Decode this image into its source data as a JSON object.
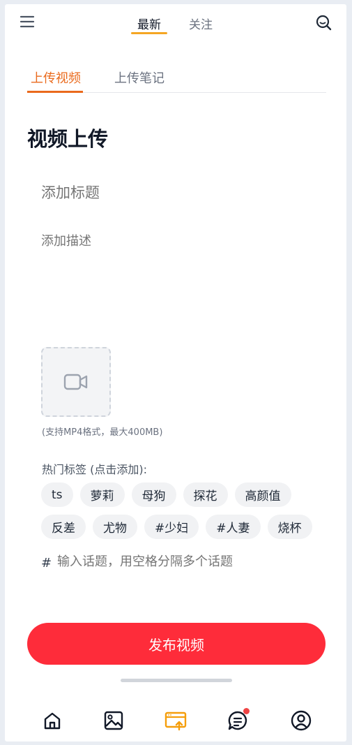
{
  "topnav": {
    "tabs": [
      "最新",
      "关注"
    ],
    "active_tab": "最新",
    "menu_icon": "hamburger-menu-icon",
    "search_icon": "search-icon"
  },
  "subtabs": {
    "items": [
      "上传视频",
      "上传笔记"
    ],
    "active": "上传视频"
  },
  "page": {
    "title": "视频上传"
  },
  "form": {
    "title_placeholder": "添加标题",
    "description_placeholder": "添加描述",
    "upload_icon": "video-camera-icon",
    "upload_hint": "(支持MP4格式，最大400MB)",
    "tags_label": "热门标签 (点击添加):",
    "tags_row1": [
      "ts",
      "萝莉",
      "母狗",
      "探花",
      "高颜值"
    ],
    "tags_row2": [
      "反差",
      "尤物",
      "#少妇",
      "#人妻",
      "烧杯"
    ],
    "topic_hash": "#",
    "topic_placeholder": "输入话题，用空格分隔多个话题",
    "publish_label": "发布视频"
  },
  "bottomnav": {
    "items": [
      "home-icon",
      "image-gallery-icon",
      "upload-icon",
      "messages-icon",
      "profile-icon"
    ],
    "active": "upload-icon",
    "messages_has_badge": true
  },
  "colors": {
    "accent_orange": "#ea6a1c",
    "tab_underline": "#f5a623",
    "publish_red": "#fe2c3a",
    "upload_active": "#f59e0b"
  }
}
